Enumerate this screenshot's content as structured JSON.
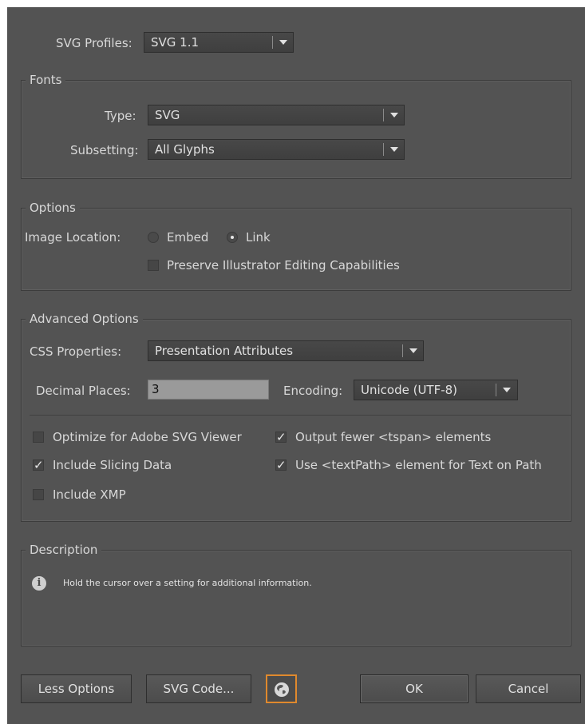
{
  "profiles": {
    "label": "SVG Profiles:",
    "value": "SVG 1.1"
  },
  "fonts": {
    "title": "Fonts",
    "type_label": "Type:",
    "type_value": "SVG",
    "subsetting_label": "Subsetting:",
    "subsetting_value": "All Glyphs"
  },
  "options": {
    "title": "Options",
    "image_location_label": "Image Location:",
    "embed_label": "Embed",
    "embed_selected": false,
    "link_label": "Link",
    "link_selected": true,
    "preserve_label": "Preserve Illustrator Editing Capabilities",
    "preserve_checked": false
  },
  "advanced": {
    "title": "Advanced Options",
    "css_label": "CSS Properties:",
    "css_value": "Presentation Attributes",
    "decimal_label": "Decimal Places:",
    "decimal_value": "3",
    "encoding_label": "Encoding:",
    "encoding_value": "Unicode (UTF-8)",
    "optimize_label": "Optimize for Adobe SVG Viewer",
    "optimize_checked": false,
    "tspan_label": "Output fewer <tspan> elements",
    "tspan_checked": true,
    "slicing_label": "Include Slicing Data",
    "slicing_checked": true,
    "textpath_label": "Use <textPath> element for Text on Path",
    "textpath_checked": true,
    "xmp_label": "Include XMP",
    "xmp_checked": false,
    "check_mark": "✓"
  },
  "description": {
    "title": "Description",
    "info_icon": "i",
    "text": "Hold the cursor over a setting for additional information."
  },
  "buttons": {
    "less_options": "Less Options",
    "svg_code": "SVG Code...",
    "globe_icon": "globe-icon",
    "ok": "OK",
    "cancel": "Cancel"
  },
  "colors": {
    "panel": "#535353",
    "focus_ring": "#e0892d"
  }
}
